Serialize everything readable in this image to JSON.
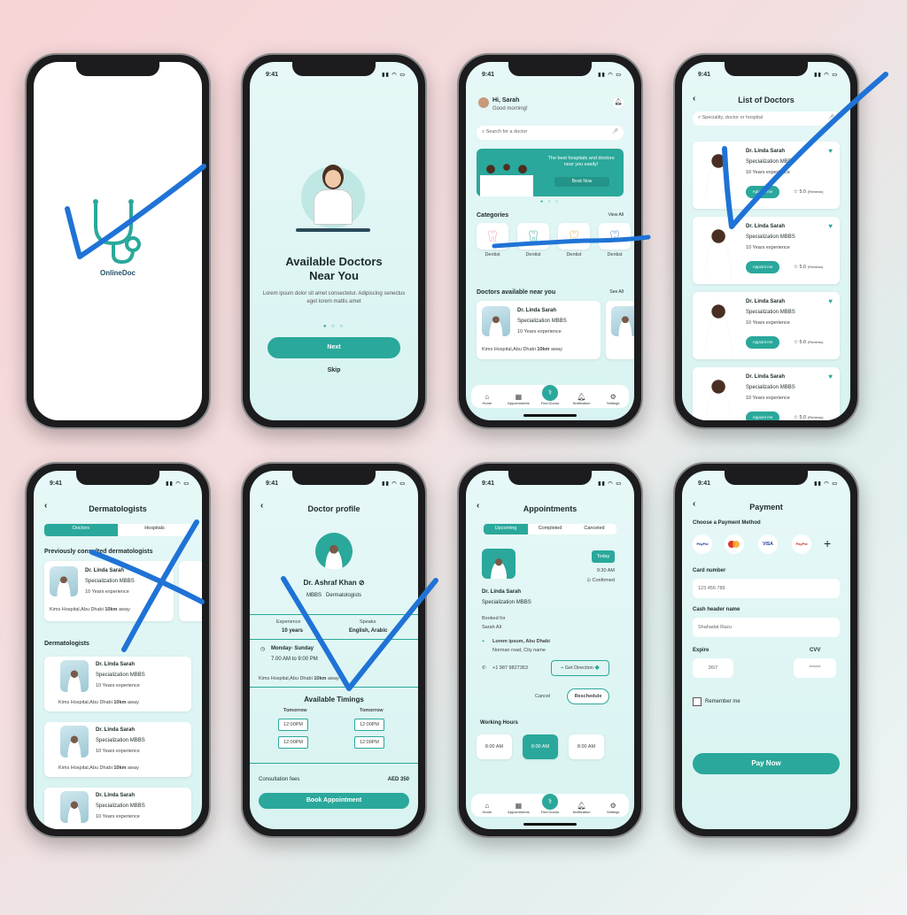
{
  "time": "9:41",
  "splash": {
    "brand": "OnlineDoc"
  },
  "onboard": {
    "title": "Available Doctors Near You",
    "body": "Lorem ipsum dolor sit amet consectetur. Adipiscing senectus eget lorem mattis amet",
    "next": "Next",
    "skip": "Skip"
  },
  "home": {
    "greet": "Hi, Sarah",
    "sub": "Good morning!",
    "search": "Search for a doctor",
    "banner": "The best hospitals and doctors near you easily!",
    "book": "Book Now",
    "categories": "Categories",
    "viewall": "View All",
    "cat": [
      "Dentist",
      "Dentist",
      "Dentist",
      "Dentist"
    ],
    "near": "Doctors available near you",
    "seeall": "See All",
    "doc": "Dr. Linda Sarah",
    "spec": "Specialization MBBS",
    "exp": "10 Years experience",
    "loc": "Kims Hospital,Abu Dhabi",
    "dist": "10km",
    "away": "away"
  },
  "tabs": [
    "Home",
    "Appointments",
    "Find Doctor",
    "Notification",
    "Settings"
  ],
  "list": {
    "title": "List of Doctors",
    "search": "Speciality, doctor or hospital",
    "docs": [
      {
        "name": "Dr. Linda Sarah",
        "spec": "Specialization MBBS",
        "exp": "10 Years experience",
        "btn": "Appoint me",
        "rate": "5.0",
        "rev": "(Reviews)"
      },
      {
        "name": "Dr. Linda Sarah",
        "spec": "Specialization MBBS",
        "exp": "10 Years experience",
        "btn": "Appoint me",
        "rate": "5.0",
        "rev": "(Reviews)"
      },
      {
        "name": "Dr. Linda Sarah",
        "spec": "Specialization MBBS",
        "exp": "10 Years experience",
        "btn": "Appoint me",
        "rate": "5.0",
        "rev": "(Reviews)"
      },
      {
        "name": "Dr. Linda Sarah",
        "spec": "Specialization MBBS",
        "exp": "10 Years experience",
        "btn": "Appoint me",
        "rate": "5.0",
        "rev": "(Reviews)"
      }
    ]
  },
  "derm": {
    "title": "Dermatologists",
    "tab1": "Doctors",
    "tab2": "Hospitals",
    "prev": "Previously consulted dermatologists",
    "section": "Dermatologists",
    "doc": "Dr. Linda Sarah",
    "spec": "Specialization MBBS",
    "exp": "10 Years experience",
    "loc": "Kims Hospital,Abu Dhabi",
    "dist": "10km",
    "away": "away"
  },
  "profile": {
    "title": "Doctor profile",
    "name": "Dr. Ashraf Khan",
    "degree": "MBBS",
    "spec": "Dermatologists",
    "exp_l": "Experience",
    "exp_v": "10 years",
    "speak_l": "Speaks",
    "speak_v": "English, Arabic",
    "days": "Monday- Sunday",
    "hours": "7.00 AM to 9:00 PM",
    "loc": "Kims Hospital,Abu Dhabi",
    "dist": "10km",
    "away": "away",
    "timings": "Available Timings",
    "tomorrow": "Tomorrow",
    "slot": "12:00PM",
    "fees_l": "Consultation fees",
    "fees_v": "AED 350",
    "book": "Book Appointment"
  },
  "appt": {
    "title": "Appointments",
    "t1": "Upcoming",
    "t2": "Completed",
    "t3": "Canceled",
    "today": "Today",
    "time": "9:30 AM",
    "status": "Confirmed",
    "doc": "Dr. Linda Sarah",
    "spec": "Specialization MBBS",
    "booked": "Booked for",
    "patient": "Sarah Ali",
    "addr1": "Lorem ipsum, Abu Dhabi",
    "addr2": "Norman road, City name",
    "phone": "+1 987 9827363",
    "dir": "Get Direction",
    "cancel": "Cancel",
    "resched": "Reschedule",
    "wh": "Working Hours",
    "slot": "8:00 AM"
  },
  "pay": {
    "title": "Payment",
    "choose": "Choose a Payment Method",
    "methods": [
      "PayPal",
      "",
      "VISA",
      "PayPal"
    ],
    "card_l": "Card number",
    "card_v": "123   456   789",
    "name_l": "Cash header name",
    "name_v": "Shahadat Razu",
    "exp_l": "Expire",
    "exp_v": "36/7",
    "cvv_l": "CVV",
    "cvv_v": "******",
    "remember": "Remember me",
    "pay": "Pay Now"
  },
  "colors": {
    "accent": "#2aa89b",
    "stroke": "#1f73d6"
  }
}
